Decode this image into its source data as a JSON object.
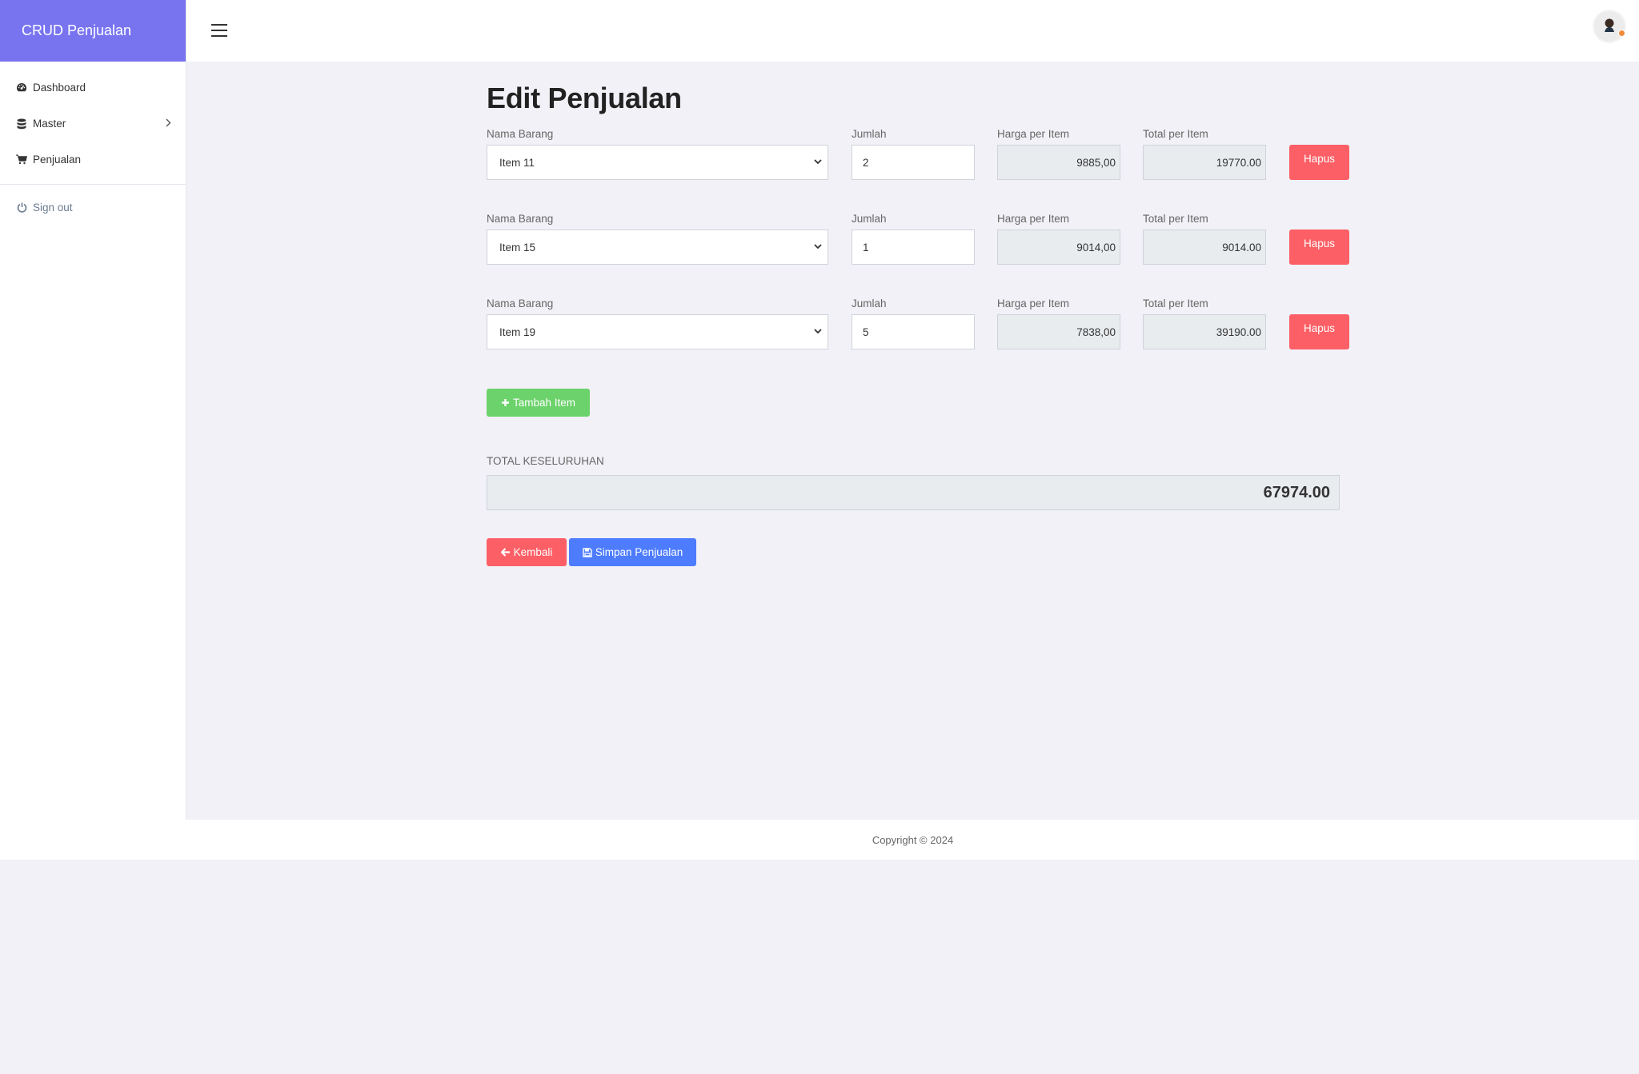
{
  "brand": "CRUD Penjualan",
  "sidebar": {
    "items": [
      {
        "label": "Dashboard",
        "icon": "tachometer-icon"
      },
      {
        "label": "Master",
        "icon": "database-icon"
      },
      {
        "label": "Penjualan",
        "icon": "cart-icon"
      }
    ],
    "signout": "Sign out"
  },
  "page_title": "Edit Penjualan",
  "labels": {
    "nama": "Nama Barang",
    "jumlah": "Jumlah",
    "harga": "Harga per Item",
    "total": "Total per Item",
    "hapus": "Hapus"
  },
  "rows": [
    {
      "item": "Item 11",
      "qty": "2",
      "price": "9885,00",
      "total": "19770.00"
    },
    {
      "item": "Item 15",
      "qty": "1",
      "price": "9014,00",
      "total": "9014.00"
    },
    {
      "item": "Item 19",
      "qty": "5",
      "price": "7838,00",
      "total": "39190.00"
    }
  ],
  "add_label": "Tambah Item",
  "grand_label": "TOTAL KESELURUHAN",
  "grand_total": "67974.00",
  "back_label": "Kembali",
  "save_label": "Simpan Penjualan",
  "footer": "Copyright © 2024",
  "colors": {
    "brand": "#7874ef",
    "danger": "#fc5f65",
    "success": "#6cd26b",
    "primary": "#4d7cfe"
  }
}
